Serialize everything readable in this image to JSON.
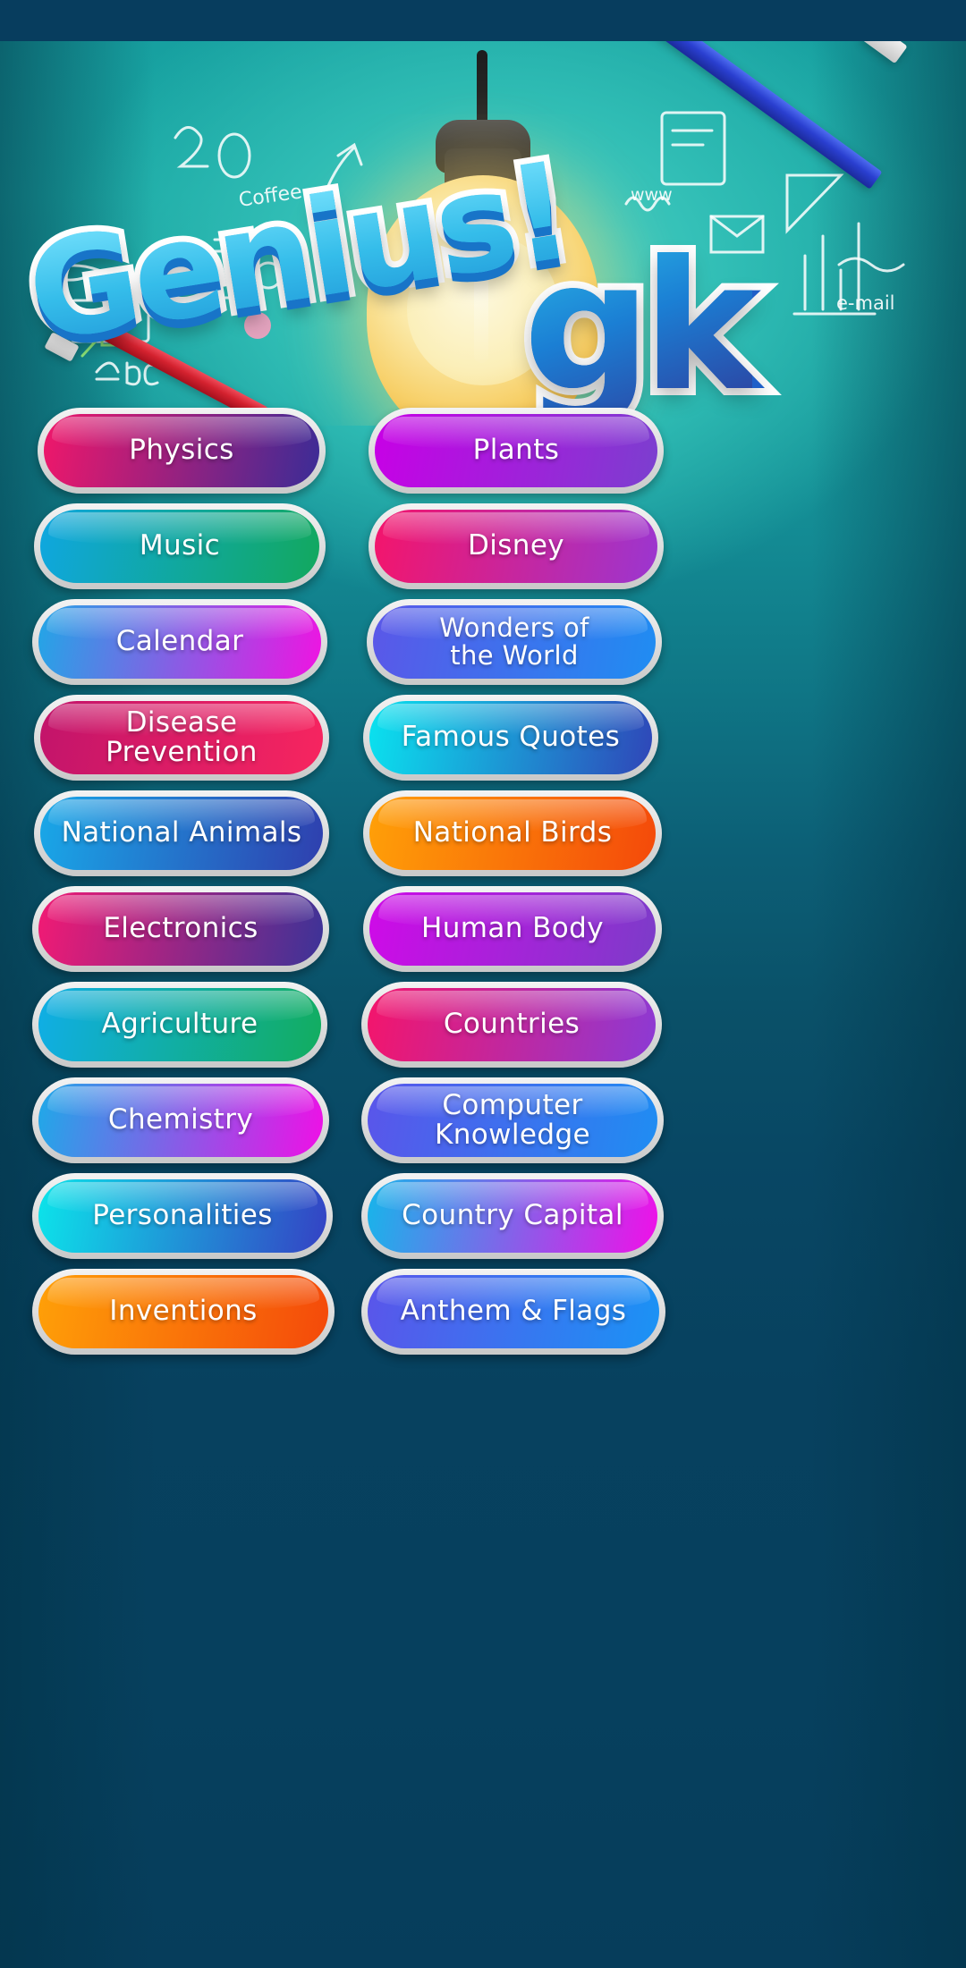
{
  "app": {
    "title": "Genius! gk",
    "logo_main": "Genius!",
    "logo_sub": "gk",
    "statusbar_color": "#073d5e",
    "background_top_color": "#17a0a0",
    "background_bottom_color": "#063d5b",
    "button_bezel_color": "#e6e6e6",
    "button_text_color": "#ffffff"
  },
  "hero": {
    "doodle_texts": [
      "20",
      "Coffee",
      "www",
      "e-mail",
      "PENCIL"
    ],
    "bulb_color": "#f7d069"
  },
  "menu": {
    "columns": 2,
    "rows": 10,
    "items": [
      {
        "label": "Physics",
        "column": "left",
        "row": 1,
        "grad_from": "#f0176a",
        "grad_to": "#3b2c96",
        "lines": 1
      },
      {
        "label": "Plants",
        "column": "right",
        "row": 1,
        "grad_from": "#c800e6",
        "grad_to": "#7b3fcf",
        "lines": 1
      },
      {
        "label": "Music",
        "column": "left",
        "row": 2,
        "grad_from": "#0fa7e0",
        "grad_to": "#12a85e",
        "lines": 1
      },
      {
        "label": "Disney",
        "column": "right",
        "row": 2,
        "grad_from": "#f4156b",
        "grad_to": "#9b36d0",
        "lines": 1
      },
      {
        "label": "Calendar",
        "column": "left",
        "row": 3,
        "grad_from": "#22a6e6",
        "grad_to": "#ef14e2",
        "lines": 1
      },
      {
        "label": "Wonders of\nthe World",
        "column": "right",
        "row": 3,
        "grad_from": "#5b57e8",
        "grad_to": "#1f8df2",
        "lines": 2
      },
      {
        "label": "Disease Prevention",
        "column": "left",
        "row": 4,
        "grad_from": "#c2146b",
        "grad_to": "#f7255f",
        "lines": 1
      },
      {
        "label": "Famous Quotes",
        "column": "right",
        "row": 4,
        "grad_from": "#0ae3ef",
        "grad_to": "#2f46b8",
        "lines": 1
      },
      {
        "label": "National Animals",
        "column": "left",
        "row": 5,
        "grad_from": "#19a8e8",
        "grad_to": "#2f3fae",
        "lines": 1
      },
      {
        "label": "National Birds",
        "column": "right",
        "row": 5,
        "grad_from": "#ffa008",
        "grad_to": "#f4490a",
        "lines": 1
      },
      {
        "label": "Electronics",
        "column": "left",
        "row": 6,
        "grad_from": "#f21a74",
        "grad_to": "#3c3397",
        "lines": 1
      },
      {
        "label": "Human Body",
        "column": "right",
        "row": 6,
        "grad_from": "#cf0ae8",
        "grad_to": "#7c3cc9",
        "lines": 1
      },
      {
        "label": "Agriculture",
        "column": "left",
        "row": 7,
        "grad_from": "#10aee6",
        "grad_to": "#12ad5f",
        "lines": 1
      },
      {
        "label": "Countries",
        "column": "right",
        "row": 7,
        "grad_from": "#f4156b",
        "grad_to": "#8c3ad4",
        "lines": 1
      },
      {
        "label": "Chemistry",
        "column": "left",
        "row": 8,
        "grad_from": "#1fa9e8",
        "grad_to": "#ef10e6",
        "lines": 1
      },
      {
        "label": "Computer Knowledge",
        "column": "right",
        "row": 8,
        "grad_from": "#5a55ea",
        "grad_to": "#1f8df2",
        "lines": 1
      },
      {
        "label": "Personalities",
        "column": "left",
        "row": 9,
        "grad_from": "#0ce4ea",
        "grad_to": "#3442c4",
        "lines": 1
      },
      {
        "label": "Country Capital",
        "column": "right",
        "row": 9,
        "grad_from": "#17b5ea",
        "grad_to": "#f010e8",
        "lines": 1
      },
      {
        "label": "Inventions",
        "column": "left",
        "row": 10,
        "grad_from": "#ffa008",
        "grad_to": "#f4490a",
        "lines": 1
      },
      {
        "label": "Anthem & Flags",
        "column": "right",
        "row": 10,
        "grad_from": "#5a55ea",
        "grad_to": "#1a93f5",
        "lines": 1
      }
    ]
  }
}
